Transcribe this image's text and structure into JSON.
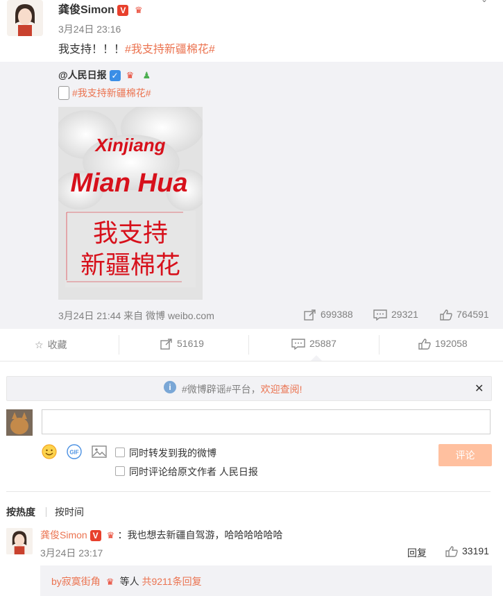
{
  "post": {
    "author": "龚俊Simon",
    "verified_badge": "V",
    "time": "3月24日 23:16",
    "text_prefix": "我支持！！！",
    "hashtag": "#我支持新疆棉花#"
  },
  "repost": {
    "author": "@人民日报",
    "hashtag": "#我支持新疆棉花#",
    "image_text": {
      "line1": "Xinjiang",
      "line2": "Mian Hua",
      "line3": "我支持",
      "line4": "新疆棉花"
    },
    "meta": "3月24日 21:44 来自 微博 weibo.com",
    "stats": {
      "reposts": "699388",
      "comments": "29321",
      "likes": "764591"
    }
  },
  "actions": {
    "favorite_label": "收藏",
    "repost_count": "51619",
    "comment_count": "25887",
    "like_count": "192058"
  },
  "notice": {
    "prefix": "#微博辟谣#平台，",
    "link": "欢迎查阅!"
  },
  "composer": {
    "placeholder": "",
    "check_repost": "同时转发到我的微博",
    "check_comment": "同时评论给原文作者 人民日报",
    "submit": "评论"
  },
  "sort": {
    "hot": "按热度",
    "time": "按时间"
  },
  "comment": {
    "author": "龚俊Simon",
    "text": "：我也想去新疆自驾游，哈哈哈哈哈哈",
    "time": "3月24日 23:17",
    "reply_label": "回复",
    "likes": "33191",
    "sub_prefix": "by寂寞街角",
    "sub_mid": " 等人 ",
    "sub_count": "共9211条回复"
  },
  "colors": {
    "accent": "#eb7350",
    "red": "#d7101b",
    "muted": "#808080"
  }
}
